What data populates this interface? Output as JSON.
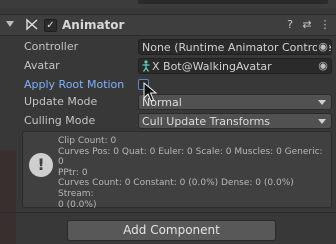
{
  "header": {
    "title": "Animator",
    "enabled_check": "✓",
    "help_icon": "?",
    "preset_icon": "⇄",
    "menu_icon": "⋮"
  },
  "fields": {
    "controller": {
      "label": "Controller",
      "value": "None (Runtime Animator Controlle"
    },
    "avatar": {
      "label": "Avatar",
      "value": "X Bot@WalkingAvatar"
    },
    "apply_root_motion": {
      "label": "Apply Root Motion",
      "checked": false
    },
    "update_mode": {
      "label": "Update Mode",
      "value": "Normal"
    },
    "culling_mode": {
      "label": "Culling Mode",
      "value": "Cull Update Transforms"
    }
  },
  "info": {
    "icon": "!",
    "lines": [
      "Clip Count: 0",
      "Curves Pos: 0 Quat: 0 Euler: 0 Scale: 0 Muscles: 0 Generic: 0",
      "PPtr: 0",
      "Curves Count: 0 Constant: 0 (0.0%) Dense: 0 (0.0%) Stream:",
      "0 (0.0%)"
    ]
  },
  "add_component_label": "Add Component",
  "colors": {
    "background": "#383838",
    "field_bg": "#2a2a2a",
    "label_highlight": "#7fb2ff",
    "button_bg": "#585858"
  }
}
